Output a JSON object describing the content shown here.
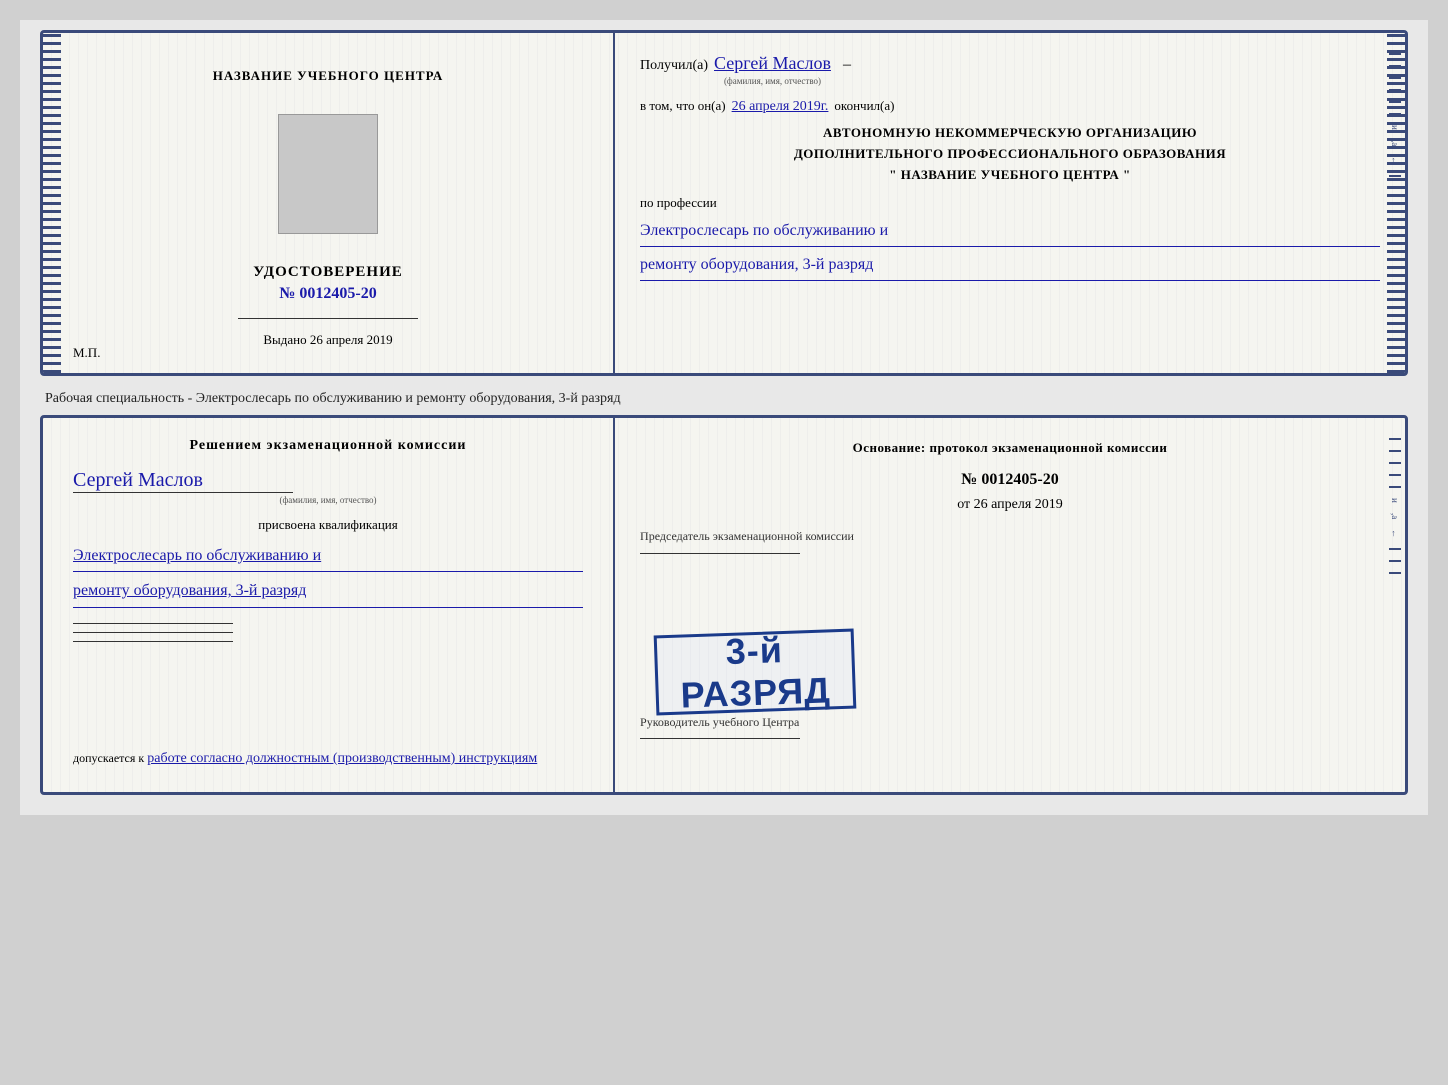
{
  "page": {
    "background": "#d0d0d0"
  },
  "card1": {
    "left": {
      "training_center": "НАЗВАНИЕ УЧЕБНОГО ЦЕНТРА",
      "udost": "УДОСТОВЕРЕНИЕ",
      "number_label": "№",
      "number": "0012405-20",
      "vydano_label": "Выдано",
      "vydano_date": "26 апреля 2019",
      "mp_label": "М.П."
    },
    "right": {
      "poluchil_label": "Получил(а)",
      "poluchil_name": "Сергей Маслов",
      "fio_label": "(фамилия, имя, отчество)",
      "vtom_label": "в том, что он(а)",
      "vtom_date": "26 апреля 2019г.",
      "okonchil_label": "окончил(а)",
      "org_line1": "АВТОНОМНУЮ НЕКОММЕРЧЕСКУЮ ОРГАНИЗАЦИЮ",
      "org_line2": "ДОПОЛНИТЕЛЬНОГО ПРОФЕССИОНАЛЬНОГО ОБРАЗОВАНИЯ",
      "org_line3": "\"  НАЗВАНИЕ УЧЕБНОГО ЦЕНТРА  \"",
      "po_professii_label": "по профессии",
      "profession_line1": "Электрослесарь по обслуживанию и",
      "profession_line2": "ремонту оборудования, 3-й разряд"
    }
  },
  "separator": {
    "text": "Рабочая специальность - Электрослесарь по обслуживанию и ремонту оборудования, 3-й разряд"
  },
  "card2": {
    "left": {
      "resheniem_title": "Решением экзаменационной комиссии",
      "name": "Сергей Маслов",
      "fio_label": "(фамилия, имя, отчество)",
      "prisvoena_label": "присвоена квалификация",
      "kvalif_line1": "Электрослесарь по обслуживанию и",
      "kvalif_line2": "ремонту оборудования, 3-й разряд",
      "dopuskaetsya_label": "допускается к",
      "dopuskaetsya_text": "работе согласно должностным (производственным) инструкциям"
    },
    "right": {
      "osnovanie_label": "Основание: протокол экзаменационной комиссии",
      "number_label": "№",
      "number": "0012405-20",
      "ot_label": "от",
      "ot_date": "26 апреля 2019",
      "predsedatel_label": "Председатель экзаменационной комиссии",
      "stamp_text": "3-й РАЗРЯД",
      "rukovoditel_label": "Руководитель учебного Центра"
    }
  }
}
